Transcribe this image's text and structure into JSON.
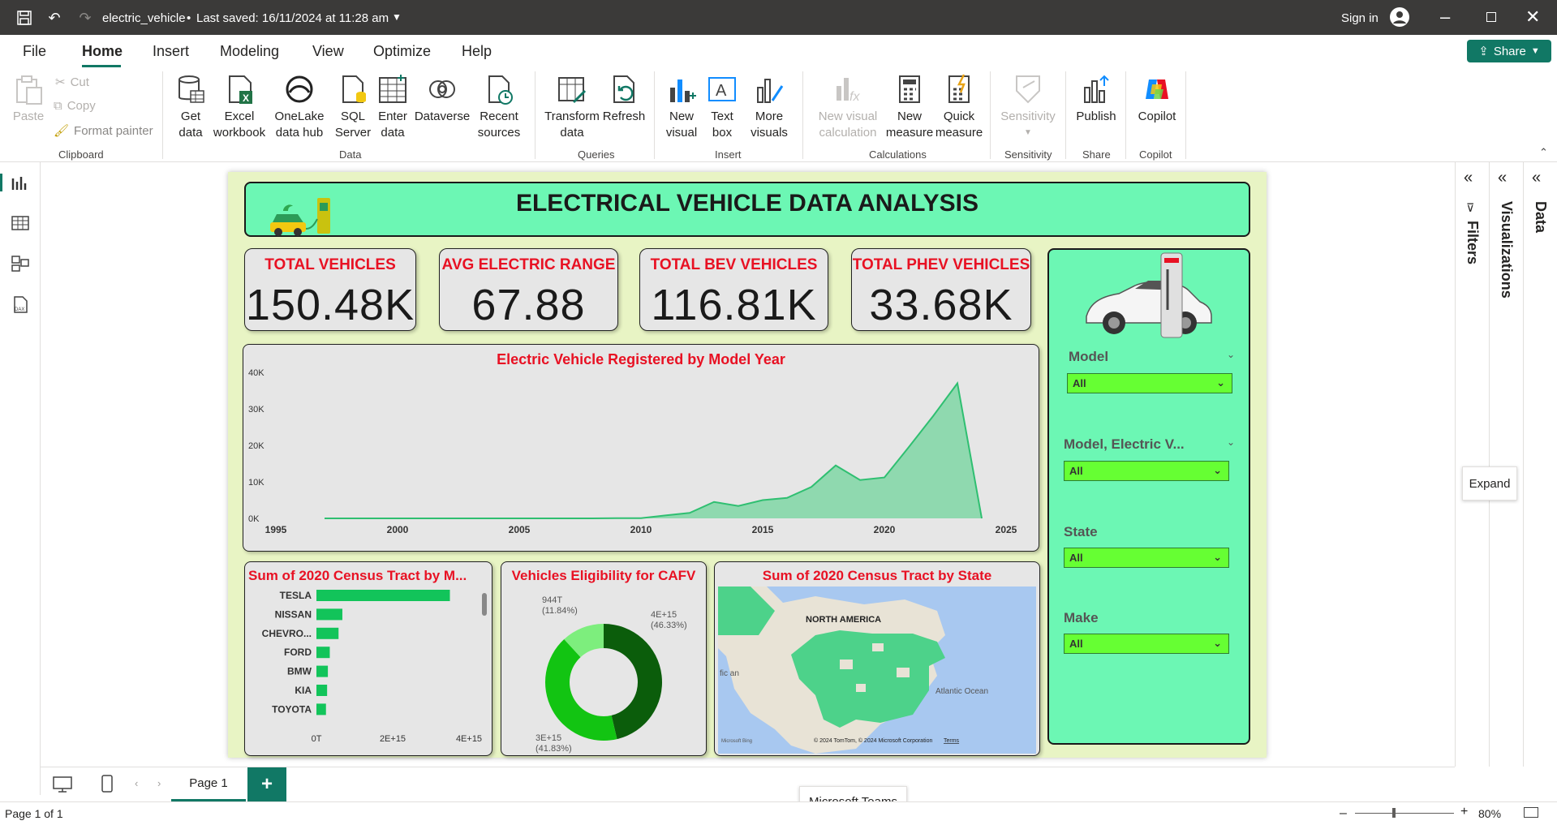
{
  "titlebar": {
    "file": "electric_vehicle",
    "saved": "Last saved: 16/11/2024 at 11:28 am",
    "signin": "Sign in"
  },
  "menu": {
    "items": [
      "File",
      "Home",
      "Insert",
      "Modeling",
      "View",
      "Optimize",
      "Help"
    ],
    "active": "Home",
    "share": "Share"
  },
  "ribbon": {
    "clipboard": {
      "paste": "Paste",
      "cut": "Cut",
      "copy": "Copy",
      "format_painter": "Format painter",
      "group": "Clipboard"
    },
    "data": {
      "get_data": "Get data",
      "excel": "Excel workbook",
      "onelake": "OneLake data hub",
      "sql": "SQL Server",
      "enter": "Enter data",
      "dataverse": "Dataverse",
      "recent": "Recent sources",
      "group": "Data"
    },
    "queries": {
      "transform": "Transform data",
      "refresh": "Refresh",
      "group": "Queries"
    },
    "insert": {
      "new_visual": "New visual",
      "text_box": "Text box",
      "more_visuals": "More visuals",
      "group": "Insert"
    },
    "calculations": {
      "new_visual_calc": "New visual calculation",
      "new_measure": "New measure",
      "quick_measure": "Quick measure",
      "group": "Calculations"
    },
    "sensitivity": {
      "label": "Sensitivity",
      "group": "Sensitivity"
    },
    "share": {
      "publish": "Publish",
      "group": "Share"
    },
    "copilot": {
      "label": "Copilot",
      "group": "Copilot"
    }
  },
  "report": {
    "title": "ELECTRICAL VEHICLE DATA ANALYSIS",
    "kpis": [
      {
        "title": "TOTAL VEHICLES",
        "value": "150.48K"
      },
      {
        "title": "AVG ELECTRIC RANGE",
        "value": "67.88"
      },
      {
        "title": "TOTAL BEV VEHICLES",
        "value": "116.81K"
      },
      {
        "title": "TOTAL PHEV VEHICLES",
        "value": "33.68K"
      }
    ],
    "slicers": [
      {
        "label": "Model",
        "value": "All"
      },
      {
        "label": "Model, Electric V...",
        "value": "All"
      },
      {
        "label": "State",
        "value": "All"
      },
      {
        "label": "Make",
        "value": "All"
      }
    ],
    "map": {
      "title": "Sum of 2020 Census Tract by State",
      "region": "NORTH AMERICA",
      "ocean": "Atlantic Ocean",
      "partial": "fic an",
      "attribution": "© 2024 TomTom, © 2024 Microsoft Corporation",
      "terms": "Terms",
      "bing": "Microsoft Bing"
    }
  },
  "chart_data": [
    {
      "type": "area",
      "title": "Electric Vehicle Registered by Model Year",
      "x": [
        1997,
        1998,
        1999,
        2000,
        2001,
        2002,
        2003,
        2004,
        2005,
        2006,
        2007,
        2008,
        2009,
        2010,
        2011,
        2012,
        2013,
        2014,
        2015,
        2016,
        2017,
        2018,
        2019,
        2020,
        2021,
        2022,
        2023,
        2024
      ],
      "values": [
        0,
        0,
        0,
        0,
        0,
        0,
        0,
        0,
        0,
        0,
        0,
        0,
        50,
        50,
        800,
        1500,
        4500,
        3400,
        5000,
        5600,
        8600,
        14500,
        10500,
        11200,
        19500,
        28000,
        37000,
        0
      ],
      "xticks": [
        "1995",
        "2000",
        "2005",
        "2010",
        "2015",
        "2020",
        "2025"
      ],
      "yticks": [
        "0K",
        "10K",
        "20K",
        "30K",
        "40K"
      ],
      "xlim": [
        1995,
        2025
      ],
      "ylim": [
        0,
        40000
      ]
    },
    {
      "type": "bar",
      "title": "Sum of 2020 Census Tract by M...",
      "categories": [
        "TESLA",
        "NISSAN",
        "CHEVRO...",
        "FORD",
        "BMW",
        "KIA",
        "TOYOTA"
      ],
      "values": [
        3500000000000000.0,
        680000000000000.0,
        580000000000000.0,
        350000000000000.0,
        300000000000000.0,
        280000000000000.0,
        250000000000000.0
      ],
      "xticks": [
        "0T",
        "2E+15",
        "4E+15"
      ],
      "xlim": [
        0,
        4000000000000000.0
      ]
    },
    {
      "type": "pie",
      "title": "Vehicles Eligibility for CAFV",
      "values": [
        46.33,
        41.83,
        11.84
      ],
      "labels": [
        "4E+15",
        "3E+15",
        "944T"
      ],
      "percent_labels": [
        "(46.33%)",
        "(41.83%)",
        "(11.84%)"
      ],
      "colors": [
        "#0b5d0b",
        "#12c412",
        "#7dee7d"
      ]
    }
  ],
  "tabs": {
    "page": "Page 1",
    "add": "+"
  },
  "status": {
    "page_of": "Page 1 of 1",
    "teams": "Microsoft Teams",
    "zoom": "80%",
    "expand": "Expand"
  },
  "panes": {
    "filters": "Filters",
    "visualizations": "Visualizations",
    "data": "Data"
  }
}
